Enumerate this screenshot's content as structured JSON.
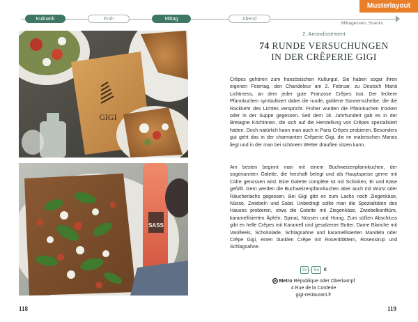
{
  "nav": {
    "timeline": [
      {
        "label": "Kulinarik",
        "state": "active"
      },
      {
        "label": "Früh",
        "state": "inactive"
      },
      {
        "label": "Mittag",
        "state": "active"
      },
      {
        "label": "Abend",
        "state": "inactive"
      }
    ],
    "tag": "Mittagessen, Snacks"
  },
  "badge": "Musterlayout",
  "images": {
    "top": {
      "logo_text": "GIGI"
    },
    "bottom": {
      "bottle_text": "SASS"
    }
  },
  "article": {
    "district": "2. Arrondissement",
    "number": "74",
    "title_line1": "RUNDE VERSUCHUNGEN",
    "title_line2": "IN DER CRÊPERIE GIGI",
    "para1": "Crêpes gehören zum französischen Kulturgut. Sie haben sogar ihren eigenen Feiertag, den Chandeleur am 2. Februar, zu Deutsch Mariä Lichtmess, an dem jeder gute Franzose Crêpes isst. Der leckere Pfannkuchen symbolisiert dabei die runde, goldene Sonnenscheibe, die die Rückkehr des Lichtes verspricht. Früher wurden die Pfannkuchen trocken oder in der Suppe gegessen. Seit dem 18. Jahrhundert gab es in der Bretagne Köchinnen, die sich auf die Herstellung von Crêpes spezialisiert hatten. Doch natürlich kann man auch in Paris Crêpes probieren. Besonders gut geht das in der charmanten Crêperie Gigi, die im malerischen Marais liegt und in der man bei schönem Wetter draußen sitzen kann.",
    "para2": "Am besten beginnt man mit einem Buchweizenpfannkuchen, der sogenannten Galette, die herzhaft belegt und als Hauptspeise gerne mit Cidre genossen wird. Eine Galette complète ist mit Schinken, Ei und Käse gefüllt. Gern werden die Buchweizenpfannkuchen aber auch mit Wurst oder Räucherlachs gegessen. Bei Gigi gibt es zum Lachs noch Ziegenkäse, Nüsse, Zwiebeln und Salat. Unbedingt sollte man die Spezialitäten des Hauses probieren, etwa die Galette mit Ziegenkäse, Zwiebelkonfitüre, karamellisierten Äpfeln, Spinat, Nüssen und Honig. Zum süßen Abschluss gibt es helle Crêpes mit Karamell und gesalzener Butter, Dame Blanche mit Vanilleeis, Schokolade, Schlagsahne und karamellisierten Mandeln oder Crêpe Gigi, einen dunklen Crêpe mit Rosenblättern, Rosensirup und Schlagsahne."
  },
  "info": {
    "day_from": "Di",
    "day_to": "So",
    "price": "€",
    "metro_label": "Metro",
    "metro_stations": "République oder Oberkampf",
    "address": "4 Rue de la Corderie",
    "website": "gigi-restaurant.fr"
  },
  "folio": {
    "left": "118",
    "right": "119"
  },
  "colors": {
    "accent": "#3e7765",
    "orange": "#e97f28"
  }
}
